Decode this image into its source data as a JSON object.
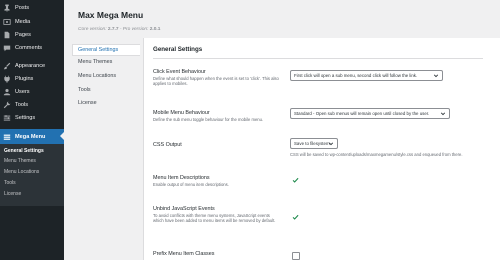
{
  "sidebar": {
    "items": [
      {
        "label": "Posts",
        "icon": "pin-icon"
      },
      {
        "label": "Media",
        "icon": "media-icon"
      },
      {
        "label": "Pages",
        "icon": "page-icon"
      },
      {
        "label": "Comments",
        "icon": "comment-icon"
      },
      {
        "label": "Appearance",
        "icon": "brush-icon"
      },
      {
        "label": "Plugins",
        "icon": "plug-icon"
      },
      {
        "label": "Users",
        "icon": "user-icon"
      },
      {
        "label": "Tools",
        "icon": "wrench-icon"
      },
      {
        "label": "Settings",
        "icon": "settings-icon"
      },
      {
        "label": "Mega Menu",
        "icon": "mega-menu-icon"
      }
    ],
    "submenu": [
      "General Settings",
      "Menu Themes",
      "Menu Locations",
      "Tools",
      "License"
    ]
  },
  "header": {
    "title": "Max Mega Menu",
    "core_label": "Core version: ",
    "core_version": "2.7.7",
    "pro_label": " - Pro version: ",
    "pro_version": "2.0.1"
  },
  "tabs": [
    "General Settings",
    "Menu Themes",
    "Menu Locations",
    "Tools",
    "License"
  ],
  "section_title": "General Settings",
  "settings": {
    "click_event": {
      "label": "Click Event Behaviour",
      "desc": "Define what should happen when the event is set to 'click'. This also applies to mobiles.",
      "value": "First click will open a sub menu, second click will follow the link."
    },
    "mobile_menu": {
      "label": "Mobile Menu Behaviour",
      "desc": "Define the sub menu toggle behaviour for the mobile menu.",
      "value": "Standard - Open sub menus will remain open until closed by the user."
    },
    "css_output": {
      "label": "CSS Output",
      "value": "Save to filesystem",
      "note": "CSS will be saved to wp-content/uploads/maxmegamenu/style.css and enqueued from there."
    },
    "menu_item_desc": {
      "label": "Menu Item Descriptions",
      "desc": "Enable output of menu item descriptions."
    },
    "unbind_js": {
      "label": "Unbind JavaScript Events",
      "desc": "To avoid conflicts with theme menu systems, JavaScript events which have been added to menu items will be removed by default."
    },
    "prefix_classes": {
      "label": "Prefix Menu Item Classes"
    }
  },
  "colors": {
    "sidebar_bg": "#1d2327",
    "accent": "#2271b1",
    "check": "#1e8a4c"
  }
}
